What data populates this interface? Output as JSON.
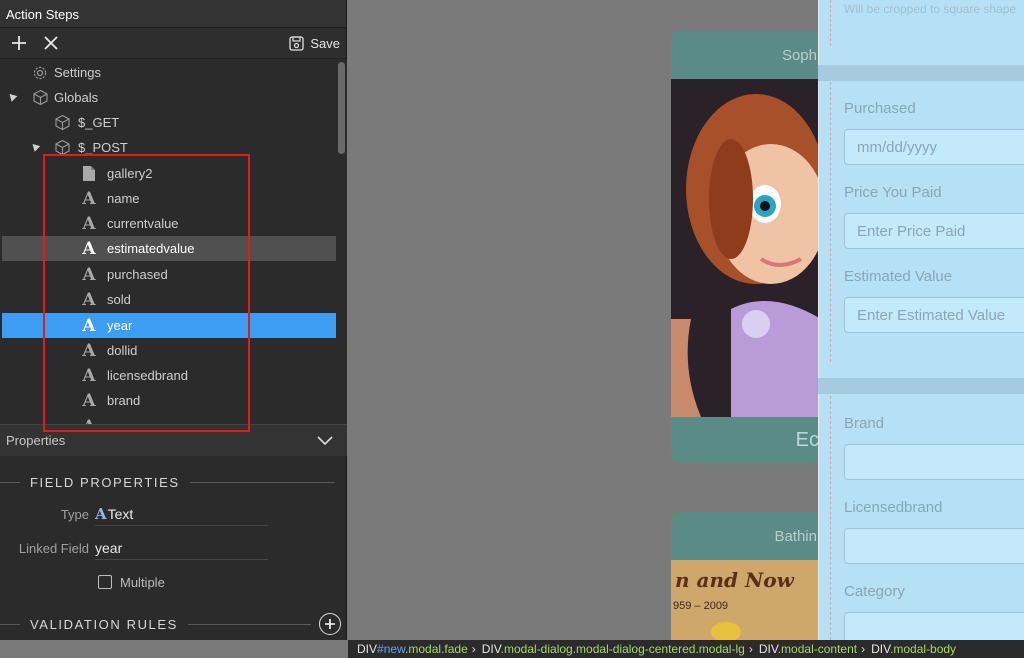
{
  "panel": {
    "title": "Action Steps",
    "save_label": "Save"
  },
  "tree": {
    "items": [
      {
        "label": "Settings",
        "icon": "gear-icon"
      },
      {
        "label": "Globals",
        "icon": "cube-icon"
      },
      {
        "label": "$_GET",
        "icon": "cube-icon"
      },
      {
        "label": "$_POST",
        "icon": "cube-icon"
      },
      {
        "label": "gallery2",
        "icon": "file-icon"
      },
      {
        "label": "name",
        "icon": "text-type-icon"
      },
      {
        "label": "currentvalue",
        "icon": "text-type-icon"
      },
      {
        "label": "estimatedvalue",
        "icon": "text-type-icon",
        "state": "hover"
      },
      {
        "label": "purchased",
        "icon": "text-type-icon"
      },
      {
        "label": "sold",
        "icon": "text-type-icon"
      },
      {
        "label": "year",
        "icon": "text-type-icon",
        "state": "selected"
      },
      {
        "label": "dollid",
        "icon": "text-type-icon"
      },
      {
        "label": "licensedbrand",
        "icon": "text-type-icon"
      },
      {
        "label": "brand",
        "icon": "text-type-icon"
      }
    ]
  },
  "properties": {
    "header": "Properties",
    "field_section": "FIELD PROPERTIES",
    "type_label": "Type",
    "type_glyph": "A",
    "type_value": "Text",
    "linked_label": "Linked Field",
    "linked_value": "year",
    "multiple_label": "Multiple",
    "validation_section": "VALIDATION RULES"
  },
  "preview": {
    "card1_title": "Soph",
    "card1_footer": "Ec",
    "card2_title": "Bathin",
    "card2_image_text": "n and Now",
    "card2_image_sub": "959 – 2009"
  },
  "form": {
    "hint": "Will be cropped to square shape",
    "fields": [
      {
        "label": "Purchased",
        "placeholder": "mm/dd/yyyy"
      },
      {
        "label": "Price You Paid",
        "placeholder": "Enter Price Paid"
      },
      {
        "label": "Estimated Value",
        "placeholder": "Enter Estimated Value"
      },
      {
        "label": "Brand",
        "placeholder": ""
      },
      {
        "label": "Licensedbrand",
        "placeholder": ""
      },
      {
        "label": "Category",
        "placeholder": ""
      }
    ]
  },
  "breadcrumb": [
    {
      "tag": "DIV",
      "hash": "#new",
      "cls": ".modal.fade"
    },
    {
      "tag": "DIV",
      "hash": "",
      "cls": ".modal-dialog.modal-dialog-centered.modal-lg"
    },
    {
      "tag": "DIV",
      "hash": "",
      "cls": ".modal-content"
    },
    {
      "tag": "DIV",
      "hash": "",
      "cls": ".modal-body"
    }
  ],
  "colors": {
    "selected": "#3d9df2",
    "highlight_box": "#e31b1b",
    "modal_bg": "#b6e0f6",
    "card_bg": "#5a8b86"
  }
}
